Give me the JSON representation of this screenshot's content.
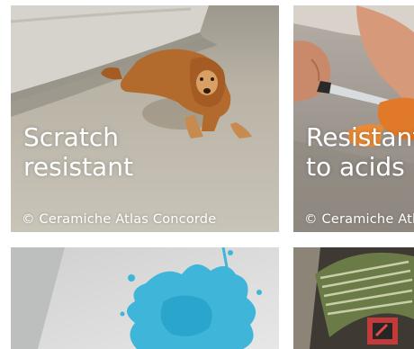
{
  "tiles": [
    {
      "caption": [
        "Scratch",
        "resistant"
      ],
      "credit": "© Ceramiche Atlas Concorde"
    },
    {
      "caption": [
        "Resistant",
        "to acids"
      ],
      "credit": "© Ceramiche Atlas Concorde"
    },
    {
      "caption": [],
      "credit": ""
    },
    {
      "caption": [],
      "credit": ""
    }
  ],
  "colors": {
    "caption_text": "#ffffff",
    "floor": "#b9b3a6",
    "sofa": "#d3d0c9",
    "dog": "#b06a2c",
    "knife_hand": "#c98a6c",
    "carrot": "#e07a2a",
    "paint_splash": "#3fb6d9",
    "grater": "#6b7b48"
  }
}
